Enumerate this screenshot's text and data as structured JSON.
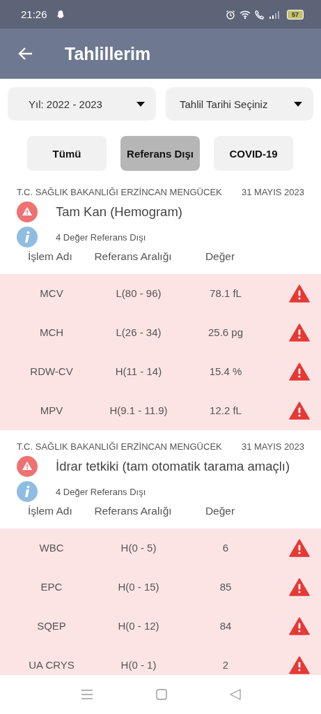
{
  "status_bar": {
    "time": "21:26",
    "battery": "57"
  },
  "app_bar": {
    "title": "Tahlillerim"
  },
  "filters": [
    {
      "label": "Yıl: 2022 - 2023"
    },
    {
      "label": "Tahlil Tarihi Seçiniz"
    }
  ],
  "tabs": [
    {
      "label": "Tümü",
      "selected": false
    },
    {
      "label": "Referans Dışı",
      "selected": true
    },
    {
      "label": "COVID-19",
      "selected": false
    }
  ],
  "results": [
    {
      "institution": "T.C. SAĞLIK BAKANLIĞI ERZİNCAN MENGÜCEK",
      "date": "31 MAYIS 2023",
      "test": "Tam Kan (Hemogram)",
      "summary": "4 Değer Referans Dışı",
      "columns": [
        "İşlem Adı",
        "Referans Aralığı",
        "Değer"
      ],
      "rows": [
        {
          "name": "MCV",
          "range": "L(80 - 96)",
          "value": "78.1 fL",
          "out_of_range": true
        },
        {
          "name": "MCH",
          "range": "L(26 - 34)",
          "value": "25.6 pg",
          "out_of_range": true
        },
        {
          "name": "RDW-CV",
          "range": "H(11 - 14)",
          "value": "15.4 %",
          "out_of_range": true
        },
        {
          "name": "MPV",
          "range": "H(9.1 - 11.9)",
          "value": "12.2 fL",
          "out_of_range": true
        }
      ]
    },
    {
      "institution": "T.C. SAĞLIK BAKANLIĞI ERZİNCAN MENGÜCEK",
      "date": "31 MAYIS 2023",
      "test": "İdrar tetkiki (tam otomatik tarama amaçlı)",
      "summary": "4 Değer Referans Dışı",
      "columns": [
        "İşlem Adı",
        "Referans Aralığı",
        "Değer"
      ],
      "rows": [
        {
          "name": "WBC",
          "range": "H(0 - 5)",
          "value": "6",
          "out_of_range": true
        },
        {
          "name": "EPC",
          "range": "H(0 - 15)",
          "value": "85",
          "out_of_range": true
        },
        {
          "name": "SQEP",
          "range": "H(0 - 12)",
          "value": "84",
          "out_of_range": true
        },
        {
          "name": "UA CRYS",
          "range": "H(0 - 1)",
          "value": "2",
          "out_of_range": true
        }
      ]
    }
  ]
}
